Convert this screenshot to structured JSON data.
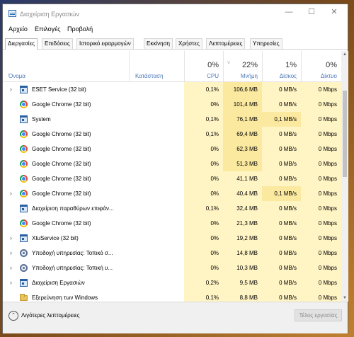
{
  "window": {
    "title": "Διαχείριση Εργασιών",
    "controls": {
      "minimize": "—",
      "maximize": "☐",
      "close": "✕"
    }
  },
  "menubar": [
    "Αρχείο",
    "Επιλογές",
    "Προβολή"
  ],
  "tabs": [
    "Διεργασίες",
    "Επιδόσεις",
    "Ιστορικό εφαρμογών",
    "Εκκίνηση",
    "Χρήστες",
    "Λεπτομέρειες",
    "Υπηρεσίες"
  ],
  "active_tab": "Διεργασίες",
  "columns": {
    "name": "Όνομα",
    "status": "Κατάσταση",
    "cpu": {
      "pct": "0%",
      "label": "CPU"
    },
    "memory": {
      "pct": "22%",
      "label": "Μνήμη"
    },
    "disk": {
      "pct": "1%",
      "label": "Δίσκος"
    },
    "network": {
      "pct": "0%",
      "label": "Δίκτυο"
    }
  },
  "sort_indicator": "˅",
  "heat_colors": {
    "light": "#fff4c4",
    "medium": "#fbe9a0"
  },
  "processes": [
    {
      "name": "ESET Service (32 bit)",
      "icon": "window-icon",
      "expandable": true,
      "status": "",
      "cpu": "0,1%",
      "memory": "106,6 MB",
      "disk": "0 MB/s",
      "network": "0 Mbps"
    },
    {
      "name": "Google Chrome (32 bit)",
      "icon": "chrome-icon",
      "expandable": false,
      "status": "",
      "cpu": "0%",
      "memory": "101,4 MB",
      "disk": "0 MB/s",
      "network": "0 Mbps"
    },
    {
      "name": "System",
      "icon": "window-icon",
      "expandable": false,
      "status": "",
      "cpu": "0,1%",
      "memory": "76,1 MB",
      "disk": "0,1 MB/s",
      "network": "0 Mbps"
    },
    {
      "name": "Google Chrome (32 bit)",
      "icon": "chrome-icon",
      "expandable": false,
      "status": "",
      "cpu": "0,1%",
      "memory": "69,4 MB",
      "disk": "0 MB/s",
      "network": "0 Mbps"
    },
    {
      "name": "Google Chrome (32 bit)",
      "icon": "chrome-icon",
      "expandable": false,
      "status": "",
      "cpu": "0%",
      "memory": "62,3 MB",
      "disk": "0 MB/s",
      "network": "0 Mbps"
    },
    {
      "name": "Google Chrome (32 bit)",
      "icon": "chrome-icon",
      "expandable": false,
      "status": "",
      "cpu": "0%",
      "memory": "51,3 MB",
      "disk": "0 MB/s",
      "network": "0 Mbps"
    },
    {
      "name": "Google Chrome (32 bit)",
      "icon": "chrome-icon",
      "expandable": false,
      "status": "",
      "cpu": "0%",
      "memory": "41,1 MB",
      "disk": "0 MB/s",
      "network": "0 Mbps"
    },
    {
      "name": "Google Chrome (32 bit)",
      "icon": "chrome-icon",
      "expandable": true,
      "status": "",
      "cpu": "0%",
      "memory": "40,4 MB",
      "disk": "0,1 MB/s",
      "network": "0 Mbps"
    },
    {
      "name": "Διαχείριση παραθύρων επιφάν...",
      "icon": "window-icon",
      "expandable": false,
      "status": "",
      "cpu": "0,1%",
      "memory": "32,4 MB",
      "disk": "0 MB/s",
      "network": "0 Mbps"
    },
    {
      "name": "Google Chrome (32 bit)",
      "icon": "chrome-icon",
      "expandable": false,
      "status": "",
      "cpu": "0%",
      "memory": "21,3 MB",
      "disk": "0 MB/s",
      "network": "0 Mbps"
    },
    {
      "name": "XtuService (32 bit)",
      "icon": "window-icon",
      "expandable": true,
      "status": "",
      "cpu": "0%",
      "memory": "19,2 MB",
      "disk": "0 MB/s",
      "network": "0 Mbps"
    },
    {
      "name": "Υποδοχή υπηρεσίας: Τοπικό σ...",
      "icon": "gear-icon",
      "expandable": true,
      "status": "",
      "cpu": "0%",
      "memory": "14,8 MB",
      "disk": "0 MB/s",
      "network": "0 Mbps"
    },
    {
      "name": "Υποδοχή υπηρεσίας: Τοπική υ...",
      "icon": "gear-icon",
      "expandable": true,
      "status": "",
      "cpu": "0%",
      "memory": "10,3 MB",
      "disk": "0 MB/s",
      "network": "0 Mbps"
    },
    {
      "name": "Διαχείριση Εργασιών",
      "icon": "window-icon",
      "expandable": true,
      "status": "",
      "cpu": "0,2%",
      "memory": "9,5 MB",
      "disk": "0 MB/s",
      "network": "0 Mbps"
    },
    {
      "name": "Εξερεύνηση των Windows",
      "icon": "folder-icon",
      "expandable": false,
      "status": "",
      "cpu": "0,1%",
      "memory": "8,8 MB",
      "disk": "0 MB/s",
      "network": "0 Mbps"
    }
  ],
  "footer": {
    "fewer_details": "Λιγότερες λεπτομέρειες",
    "end_task": "Τέλος εργασίας"
  }
}
